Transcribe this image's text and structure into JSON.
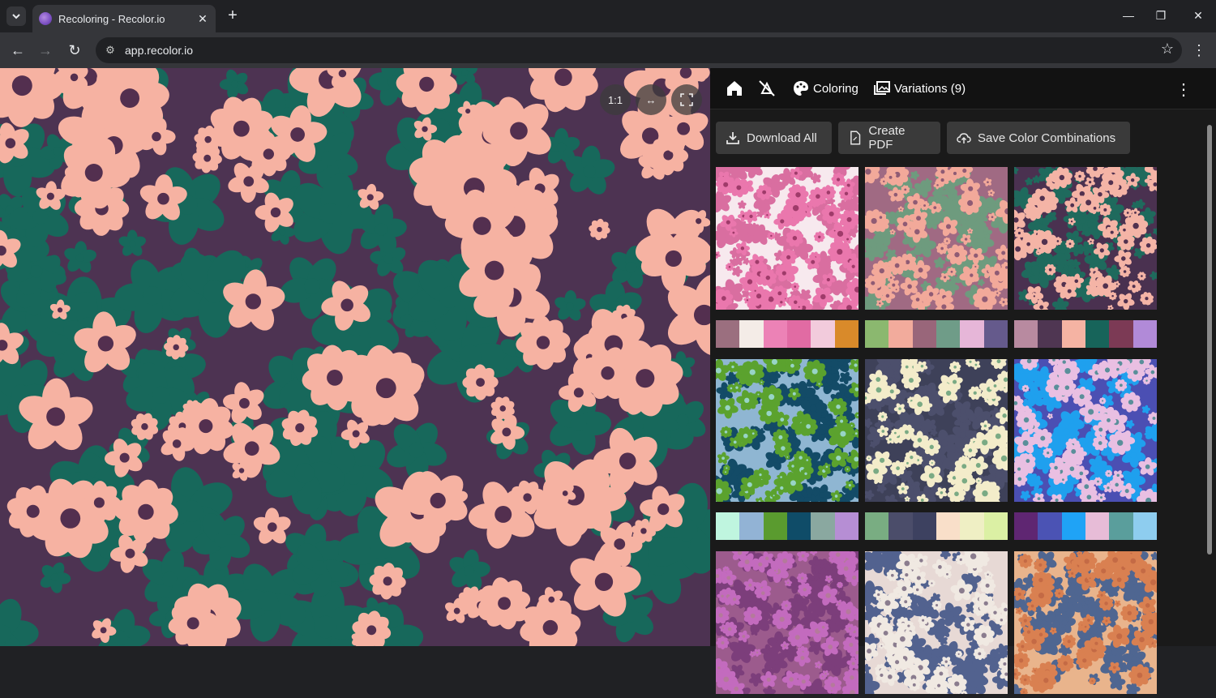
{
  "browser": {
    "tab_title": "Recoloring - Recolor.io",
    "url": "app.recolor.io"
  },
  "viewer": {
    "zoom_label": "1:1",
    "fit_label": "↔",
    "fullscreen_label": "⛶"
  },
  "panel": {
    "coloring_label": "Coloring",
    "variations_label": "Variations (9)"
  },
  "actions": {
    "download_all": "Download All",
    "create_pdf": "Create PDF",
    "save_combinations": "Save Color Combinations"
  },
  "variations": [
    {
      "bg": "#f7e9ee",
      "petal": "#ea77ad",
      "leaf": "#d96ea0",
      "center": "#9f3b6a",
      "swatches": [
        "#9b6f7f",
        "#f4ece7",
        "#ec82b6",
        "#e16ba3",
        "#f2cbdc",
        "#d98a2a"
      ]
    },
    {
      "bg": "#a06a83",
      "petal": "#f2a99a",
      "leaf": "#6e9b7e",
      "center": "#8f5b74",
      "swatches": [
        "#8bb86f",
        "#f2ab9c",
        "#99667a",
        "#6f9c88",
        "#e6b6d8",
        "#655a8c"
      ]
    },
    {
      "bg": "#4a3150",
      "petal": "#f4b4a6",
      "leaf": "#1f6a5d",
      "center": "#51314f",
      "swatches": [
        "#b88aa0",
        "#4f3652",
        "#f5b3a3",
        "#17645a",
        "#7c3a55",
        "#b18ad8"
      ]
    },
    {
      "bg": "#8fb6d2",
      "petal": "#5ba22e",
      "leaf": "#134b67",
      "center": "#98d4c6",
      "swatches": [
        "#bff5df",
        "#92b3d5",
        "#5a9b2f",
        "#0f4c68",
        "#8aa8a0",
        "#b68ed4"
      ]
    },
    {
      "bg": "#3e4159",
      "petal": "#f3ecca",
      "leaf": "#4c4f6c",
      "center": "#7aaa84",
      "swatches": [
        "#79ad82",
        "#4b4d6a",
        "#3d4160",
        "#f9dfc9",
        "#efefc4",
        "#dbf0a4"
      ]
    },
    {
      "bg": "#4b4fb3",
      "petal": "#e9bfe2",
      "leaf": "#1fa0ee",
      "center": "#5a8f9a",
      "swatches": [
        "#5f2672",
        "#4b53b4",
        "#1fa3f6",
        "#e7bcd7",
        "#5a9e9c",
        "#8ecdef"
      ]
    },
    {
      "bg": "#9c5b8d",
      "petal": "#c36bbe",
      "leaf": "#7c3e7b",
      "center": "#b47a9b",
      "swatches": []
    },
    {
      "bg": "#e7d9d5",
      "petal": "#f0e9e2",
      "leaf": "#52628f",
      "center": "#8a7c8e",
      "swatches": []
    },
    {
      "bg": "#e9b48c",
      "petal": "#d98051",
      "leaf": "#4f6691",
      "center": "#c46a45",
      "swatches": []
    }
  ]
}
